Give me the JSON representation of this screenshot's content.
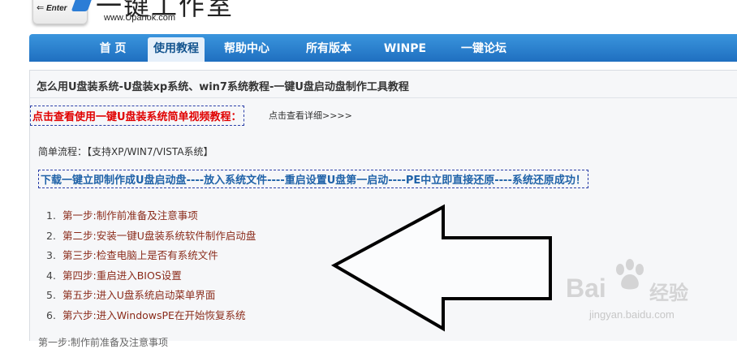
{
  "header": {
    "key_text": "Enter",
    "key_arrow": "⇐",
    "site_title": "一键工作室",
    "site_url": "www.Upanok.com"
  },
  "nav": {
    "items": [
      {
        "label": "首 页"
      },
      {
        "label": "使用教程",
        "active": true
      },
      {
        "label": "帮助中心"
      },
      {
        "label": "所有版本"
      },
      {
        "label": "WINPE"
      },
      {
        "label": "一键论坛"
      }
    ]
  },
  "article": {
    "title": "怎么用U盘装系统-U盘装xp系统、win7系统教程-一键U盘启动盘制作工具教程",
    "video_link": "点击查看使用一键U盘装系统简单视频教程：",
    "detail_link": "点击查看详细>>>>",
    "process_label": "简单流程：【支持XP/WIN7/VISTA系统】",
    "flow_text": "下载一键立即制作成U盘启动盘----放入系统文件----重启设置U盘第一启动----PE中立即直接还原----系统还原成功！",
    "steps": [
      {
        "num": "1.",
        "text": "第一步:制作前准备及注意事项"
      },
      {
        "num": "2.",
        "text": "第二步:安装一键U盘装系统软件制作启动盘"
      },
      {
        "num": "3.",
        "text": "第三步:检查电脑上是否有系统文件"
      },
      {
        "num": "4.",
        "text": "第四步:重启进入BIOS设置"
      },
      {
        "num": "5.",
        "text": "第五步:进入U盘系统启动菜单界面"
      },
      {
        "num": "6.",
        "text": "第六步:进入WindowsPE在开始恢复系统"
      }
    ],
    "last_line": "第一步:制作前准备及注意事项"
  },
  "watermark": {
    "brand": "Bai",
    "brand_suffix": "经验",
    "url": "jingyan.baidu.com"
  }
}
